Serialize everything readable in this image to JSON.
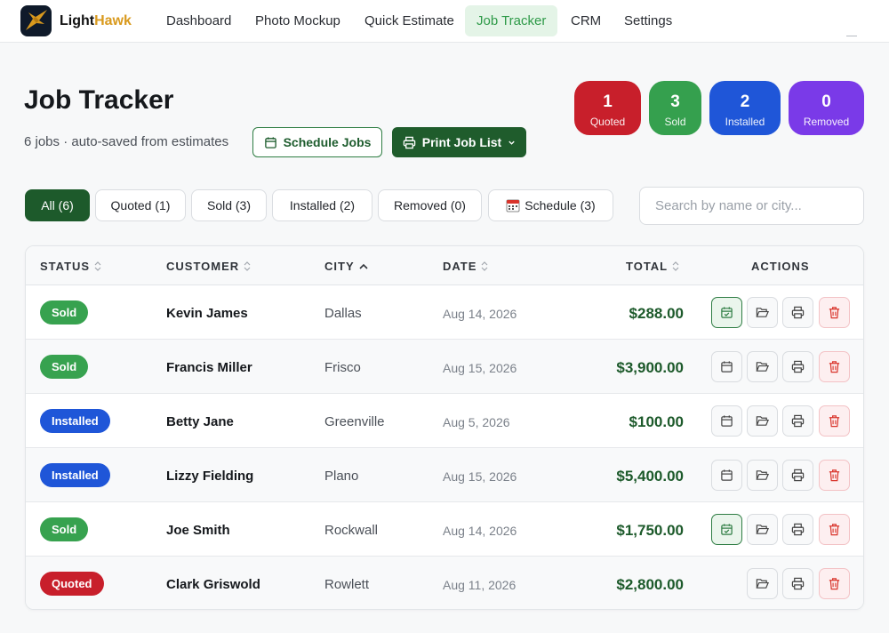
{
  "app": {
    "logo_light": "Light",
    "logo_hawk": "Hawk"
  },
  "nav": {
    "items": [
      {
        "label": "Dashboard"
      },
      {
        "label": "Photo Mockup"
      },
      {
        "label": "Quick Estimate"
      },
      {
        "label": "Job Tracker",
        "active": true
      },
      {
        "label": "CRM"
      },
      {
        "label": "Settings"
      }
    ]
  },
  "header": {
    "title": "Job Tracker",
    "subtitle": "6 jobs · auto-saved from estimates",
    "schedule_label": "Schedule Jobs",
    "print_label": "Print Job List"
  },
  "stats": [
    {
      "value": "1",
      "label": "Quoted",
      "color": "#c81f2b"
    },
    {
      "value": "3",
      "label": "Sold",
      "color": "#35a04e"
    },
    {
      "value": "2",
      "label": "Installed",
      "color": "#1f56d8"
    },
    {
      "value": "0",
      "label": "Removed",
      "color": "#7a3ae8"
    }
  ],
  "filters": [
    {
      "label": "All (6)",
      "active": true
    },
    {
      "label": "Quoted (1)"
    },
    {
      "label": "Sold (3)"
    },
    {
      "label": "Installed (2)"
    },
    {
      "label": "Removed (0)"
    },
    {
      "label": "Schedule (3)",
      "icon": "calendar-icon"
    }
  ],
  "search": {
    "placeholder": "Search by name or city..."
  },
  "table": {
    "columns": [
      {
        "label": "STATUS",
        "sort": "none"
      },
      {
        "label": "CUSTOMER",
        "sort": "none"
      },
      {
        "label": "CITY",
        "sort": "ascending"
      },
      {
        "label": "DATE",
        "sort": "none"
      },
      {
        "label": "TOTAL",
        "sort": "none"
      },
      {
        "label": "ACTIONS"
      }
    ],
    "rows": [
      {
        "status": "Sold",
        "customer": "Kevin James",
        "city": "Dallas",
        "date": "Aug 14, 2026",
        "total": "$288.00",
        "scheduled": true
      },
      {
        "status": "Sold",
        "customer": "Francis Miller",
        "city": "Frisco",
        "date": "Aug 15, 2026",
        "total": "$3,900.00",
        "scheduled": false
      },
      {
        "status": "Installed",
        "customer": "Betty Jane",
        "city": "Greenville",
        "date": "Aug 5, 2026",
        "total": "$100.00",
        "scheduled": false
      },
      {
        "status": "Installed",
        "customer": "Lizzy Fielding",
        "city": "Plano",
        "date": "Aug 15, 2026",
        "total": "$5,400.00",
        "scheduled": false
      },
      {
        "status": "Sold",
        "customer": "Joe Smith",
        "city": "Rockwall",
        "date": "Aug 14, 2026",
        "total": "$1,750.00",
        "scheduled": true
      },
      {
        "status": "Quoted",
        "customer": "Clark Griswold",
        "city": "Rowlett",
        "date": "Aug 11, 2026",
        "total": "$2,800.00",
        "scheduled": null
      }
    ]
  },
  "colors": {
    "brand_green": "#1d5a2b",
    "sold": "#37a24f",
    "installed": "#1f56d8",
    "quoted": "#c81f2b",
    "removed": "#7a3ae8"
  }
}
